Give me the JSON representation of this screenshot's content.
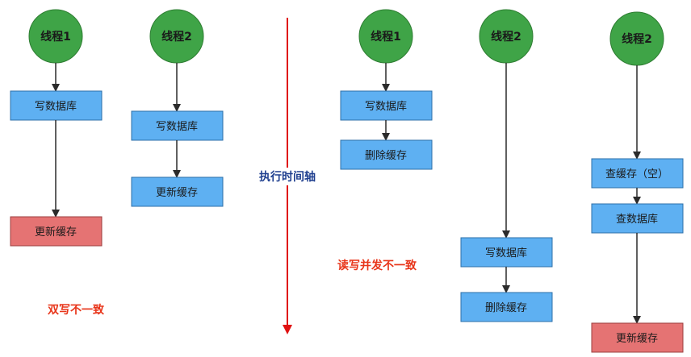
{
  "colors": {
    "thread_circle": "#3fa447",
    "process_box": "#5eb0f2",
    "cache_update_box": "#e57373",
    "arrow": "#2b2b2b",
    "timeline": "#e01010",
    "timeline_label": "#1f3f8f",
    "warning_text": "#e8351a"
  },
  "timeline": {
    "label": "执行时间轴"
  },
  "left_scenario": {
    "caption": "双写不一致",
    "thread1": {
      "name": "线程1",
      "steps": [
        "写数据库",
        "更新缓存"
      ]
    },
    "thread2": {
      "name": "线程2",
      "steps": [
        "写数据库",
        "更新缓存"
      ]
    }
  },
  "right_scenario": {
    "caption": "读写并发不一致",
    "thread1": {
      "name": "线程1",
      "steps": [
        "写数据库",
        "删除缓存"
      ]
    },
    "thread2": {
      "name": "线程2",
      "steps": [
        "写数据库",
        "删除缓存"
      ]
    },
    "thread3": {
      "name": "线程2",
      "steps": [
        "查缓存（空）",
        "查数据库",
        "更新缓存"
      ]
    }
  }
}
